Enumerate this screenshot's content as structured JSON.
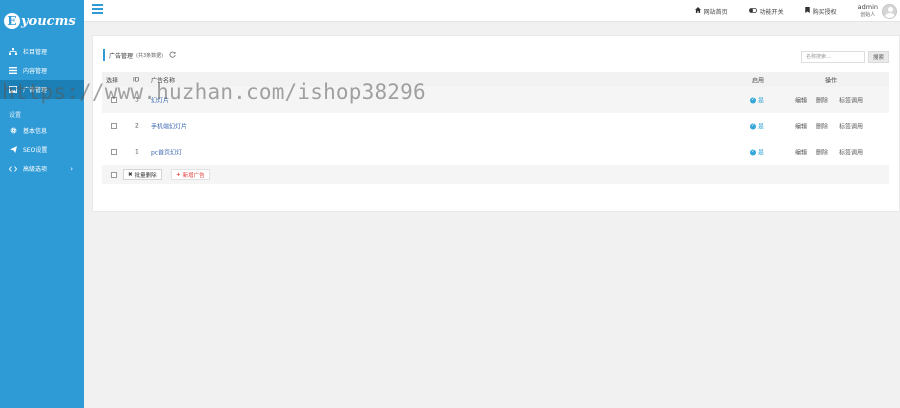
{
  "sidebar": {
    "logo_letter": "E",
    "logo_text": "youcms",
    "items": [
      {
        "label": "栏目管理",
        "icon": "sitemap-icon"
      },
      {
        "label": "内容管理",
        "icon": "list-icon"
      },
      {
        "label": "广告管理",
        "icon": "image-icon",
        "active": true
      }
    ],
    "section_label": "设置",
    "settings_items": [
      {
        "label": "基本信息",
        "icon": "gear-icon"
      },
      {
        "label": "SEO设置",
        "icon": "send-icon"
      },
      {
        "label": "高级选项",
        "icon": "code-icon",
        "has_arrow": true
      }
    ]
  },
  "topbar": {
    "links": [
      {
        "label": "网站首页",
        "icon": "home-icon"
      },
      {
        "label": "功能开关",
        "icon": "toggle-icon"
      },
      {
        "label": "购买授权",
        "icon": "bookmark-icon"
      }
    ],
    "user_name": "admin",
    "user_role": "创始人"
  },
  "panel": {
    "title": "广告管理",
    "count_text": "(共3条数据)",
    "search_placeholder": "名称搜索...",
    "search_button": "搜索"
  },
  "table": {
    "headers": {
      "select": "选择",
      "id": "ID",
      "name": "广告名称",
      "enabled": "启用",
      "actions": "操作"
    },
    "rows": [
      {
        "id": "3",
        "name": "幻灯片",
        "enabled": "是",
        "edit": "编辑",
        "delete": "删除",
        "tag": "标签调用"
      },
      {
        "id": "2",
        "name": "手机端幻灯片",
        "enabled": "是",
        "edit": "编辑",
        "delete": "删除",
        "tag": "标签调用"
      },
      {
        "id": "1",
        "name": "pc首页幻灯",
        "enabled": "是",
        "edit": "编辑",
        "delete": "删除",
        "tag": "标签调用"
      }
    ],
    "batch_delete": "批量删除",
    "add_ad": "新增广告"
  },
  "watermark": "https://www.huzhan.com/ishop38296",
  "colors": {
    "accent": "#2f9bd6",
    "active": "#1c7fb5",
    "danger": "#e03a3a",
    "link": "#3a67b0"
  }
}
